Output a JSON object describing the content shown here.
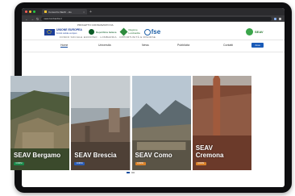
{
  "browser": {
    "tab_title": "Consorzio SEAV - Ho",
    "tab_close": "×",
    "new_tab": "+",
    "url": "seav.lombardia.it",
    "nav_back": "←",
    "nav_forward": "→",
    "nav_reload": "↻"
  },
  "header": {
    "project_label": "PROGETTO COFINANZIATO DA",
    "eu_label_line1": "UNIONE EUROPEA",
    "eu_label_line2": "Fondo sociale europeo",
    "republic_label": "Repubblica Italiana",
    "region_label_line1": "Regione",
    "region_label_line2": "Lombardia",
    "fse_label": "fse",
    "tagline": "FONDO SOCIALE EUROPEO · LOMBARDIA · OPPORTUNITÀ E RISORSE",
    "raf_label": "SEAV"
  },
  "menu": {
    "items": [
      "Home",
      "Università",
      "News",
      "Pubblicità",
      "Contatti"
    ],
    "login": "Area riservata"
  },
  "cards": [
    {
      "title": "SEAV Bergamo",
      "badge": "CORSI",
      "badge_color": "#1b8a4a"
    },
    {
      "title": "SEAV Brescia",
      "badge": "CORSI",
      "badge_color": "#2b5db8"
    },
    {
      "title": "SEAV Como",
      "badge": "CORSI",
      "badge_color": "#d9822b"
    },
    {
      "title": "SEAV Cremona",
      "badge": "CORSI",
      "badge_color": "#d9822b"
    }
  ]
}
